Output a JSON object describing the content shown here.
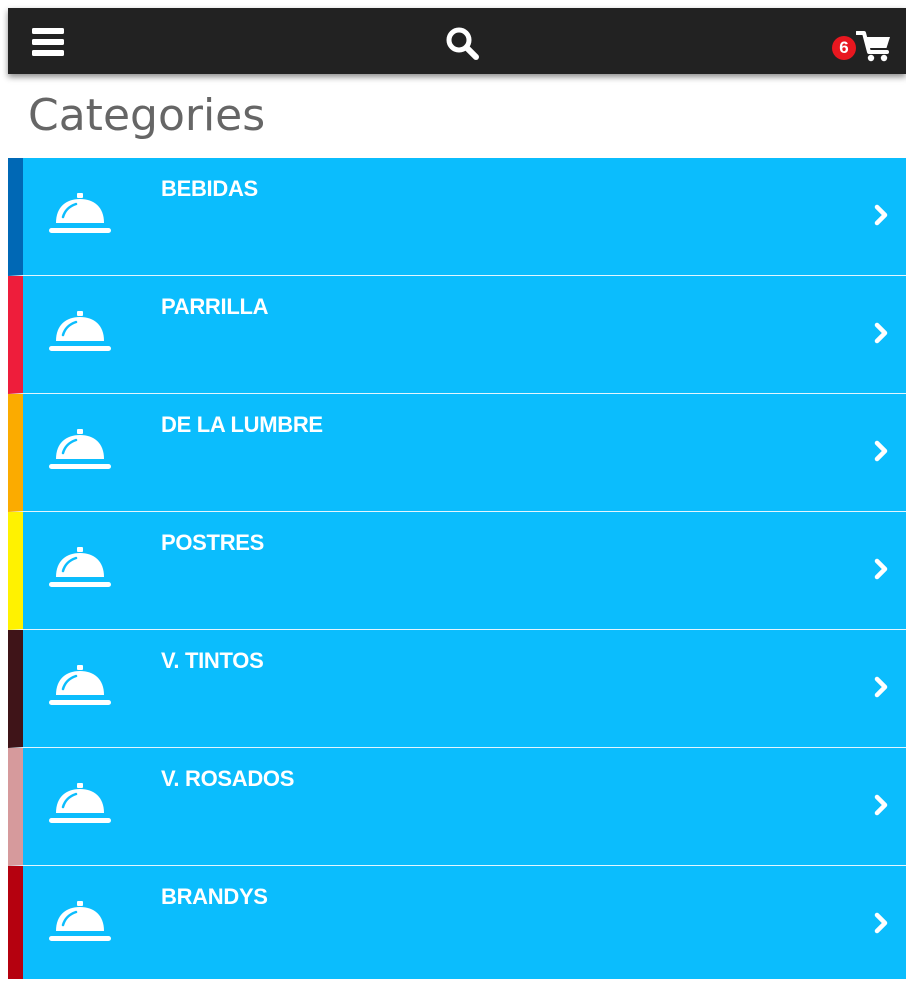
{
  "header": {
    "menu_icon": "hamburger-menu-icon",
    "search_icon": "search-icon",
    "cart_icon": "shopping-cart-icon",
    "cart_count": "6",
    "bar_color": "#222222",
    "badge_color": "#e8171f"
  },
  "page": {
    "title": "Categories"
  },
  "categories": {
    "icon": "service-bell-icon",
    "chevron_icon": "chevron-right-icon",
    "background_color": "#0bbdfd",
    "items": [
      {
        "label": "BEBIDAS",
        "accent": "#0068b5"
      },
      {
        "label": "PARRILLA",
        "accent": "#ee1d3b"
      },
      {
        "label": "DE LA LUMBRE",
        "accent": "#fbab00"
      },
      {
        "label": "POSTRES",
        "accent": "#fff200"
      },
      {
        "label": "V. TINTOS",
        "accent": "#3f1418"
      },
      {
        "label": "V. ROSADOS",
        "accent": "#d69a9c"
      },
      {
        "label": "BRANDYS",
        "accent": "#b5010f"
      }
    ]
  }
}
